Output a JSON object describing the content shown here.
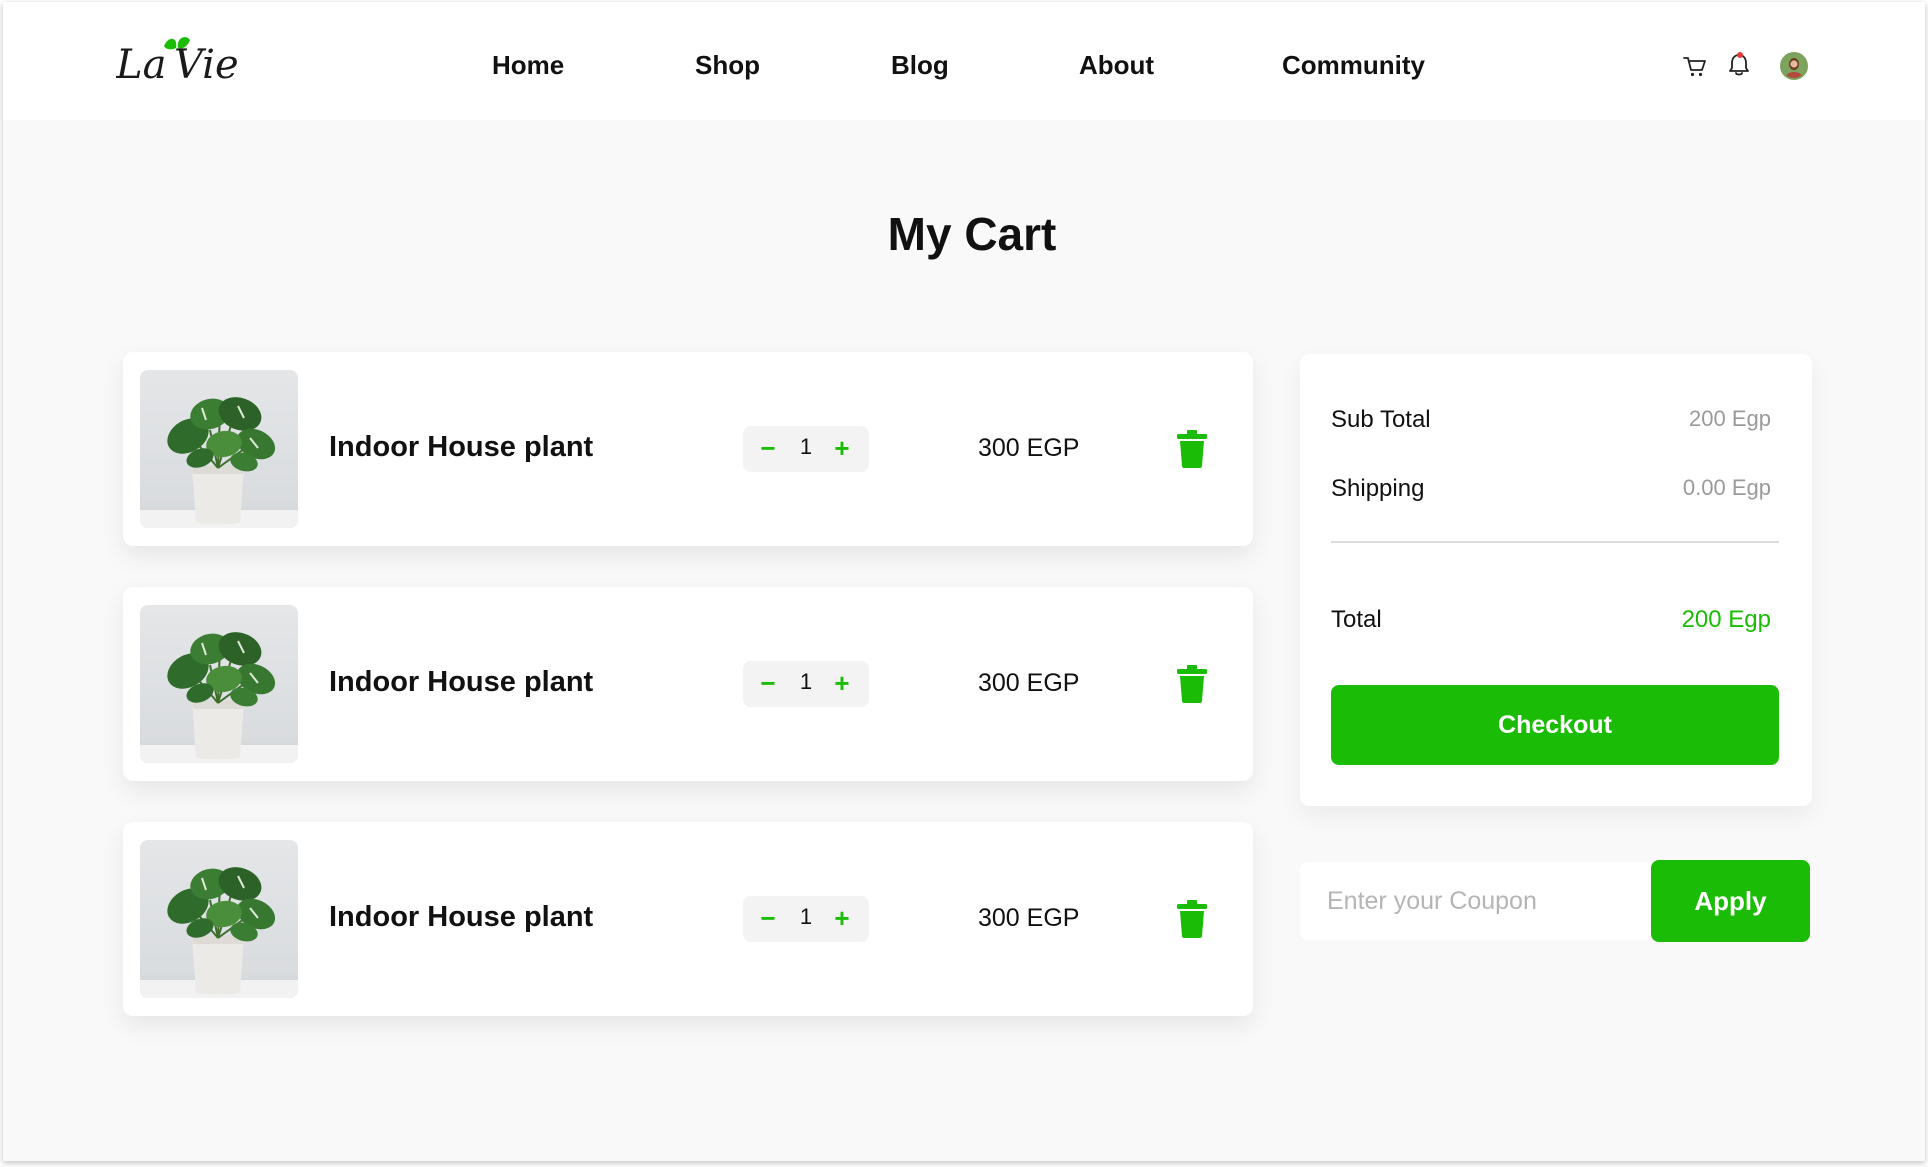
{
  "brand": {
    "logo_text": "La Vie"
  },
  "nav": {
    "items": [
      {
        "label": "Home"
      },
      {
        "label": "Shop"
      },
      {
        "label": "Blog"
      },
      {
        "label": "About"
      },
      {
        "label": "Community"
      }
    ]
  },
  "header_icons": [
    "cart-icon",
    "bell-icon",
    "avatar"
  ],
  "page": {
    "title": "My Cart"
  },
  "cart": {
    "items": [
      {
        "name": "Indoor House plant",
        "quantity": "1",
        "price": "300 EGP",
        "decrement": "−",
        "increment": "+"
      },
      {
        "name": "Indoor House plant",
        "quantity": "1",
        "price": "300 EGP",
        "decrement": "−",
        "increment": "+"
      },
      {
        "name": "Indoor House plant",
        "quantity": "1",
        "price": "300 EGP",
        "decrement": "−",
        "increment": "+"
      }
    ]
  },
  "summary": {
    "subtotal_label": "Sub Total",
    "subtotal_value": "200 Egp",
    "shipping_label": "Shipping",
    "shipping_value": "0.00 Egp",
    "total_label": "Total",
    "total_value": "200 Egp",
    "checkout_label": "Checkout"
  },
  "coupon": {
    "placeholder": "Enter your Coupon",
    "value": "",
    "apply_label": "Apply"
  },
  "colors": {
    "accent": "#1abc05",
    "page_bg": "#f9f9f9",
    "card_bg": "#ffffff",
    "muted_text": "#9a9a9a"
  }
}
